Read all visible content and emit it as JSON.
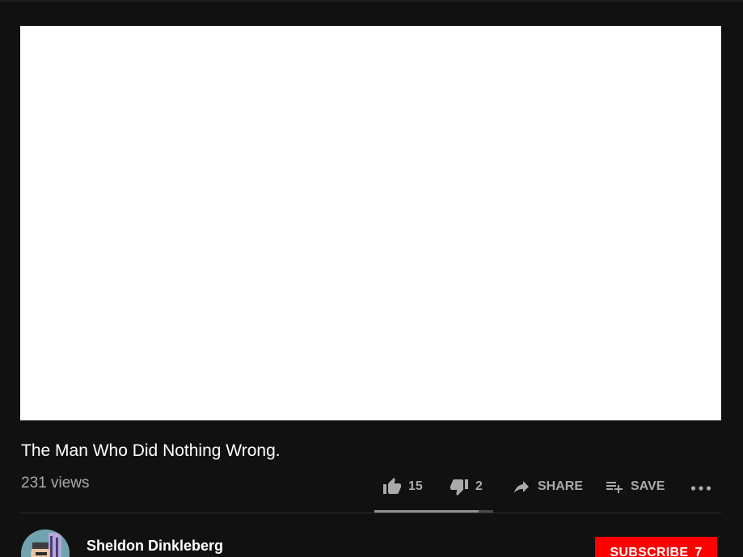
{
  "video": {
    "title": "The Man Who Did Nothing Wrong.",
    "views": "231 views",
    "like_ratio": 0.88
  },
  "actions": {
    "likes": "15",
    "dislikes": "2",
    "share_label": "SHARE",
    "save_label": "SAVE"
  },
  "channel": {
    "name": "Sheldon Dinkleberg"
  },
  "subscribe": {
    "label": "SUBSCRIBE",
    "count": "7"
  },
  "colors": {
    "background": "#111111",
    "subscribe": "#ff0000",
    "secondary_text": "#aaaaaa"
  }
}
